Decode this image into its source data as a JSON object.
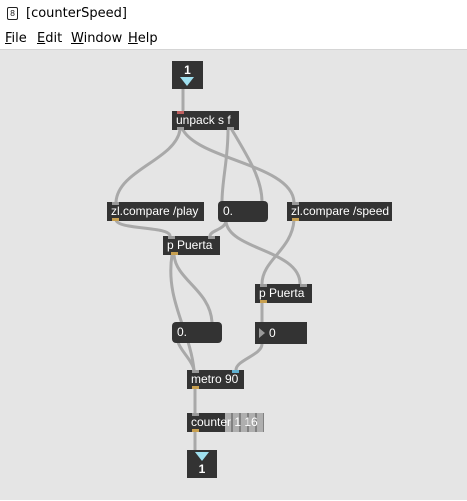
{
  "window": {
    "title": "[counterSpeed]",
    "app_icon": "max-patcher-icon"
  },
  "menu": [
    {
      "label": "File",
      "mnemonic": "F",
      "rest": "ile"
    },
    {
      "label": "Edit",
      "mnemonic": "E",
      "rest": "dit"
    },
    {
      "label": "Window",
      "mnemonic": "W",
      "rest": "indow"
    },
    {
      "label": "Help",
      "mnemonic": "H",
      "rest": "elp"
    }
  ],
  "patcher": {
    "inlet": {
      "number": "1"
    },
    "outlet": {
      "number": "1"
    },
    "unpack": {
      "text": "unpack s f"
    },
    "compare_play": {
      "text": "zl.compare /play"
    },
    "compare_speed": {
      "text": "zl.compare /speed"
    },
    "puerta_left": {
      "text": "p Puerta"
    },
    "puerta_right": {
      "text": "p Puerta"
    },
    "float_top": {
      "text": "0."
    },
    "float_bottom": {
      "text": "0."
    },
    "int_box": {
      "text": "0"
    },
    "metro": {
      "text": "metro 90"
    },
    "counter": {
      "text": "counter 1 16"
    }
  },
  "colors": {
    "canvas": "#e5e5e5",
    "object": "#333333",
    "wire": "#a9a9a9",
    "arrow": "#9fe0ef"
  }
}
